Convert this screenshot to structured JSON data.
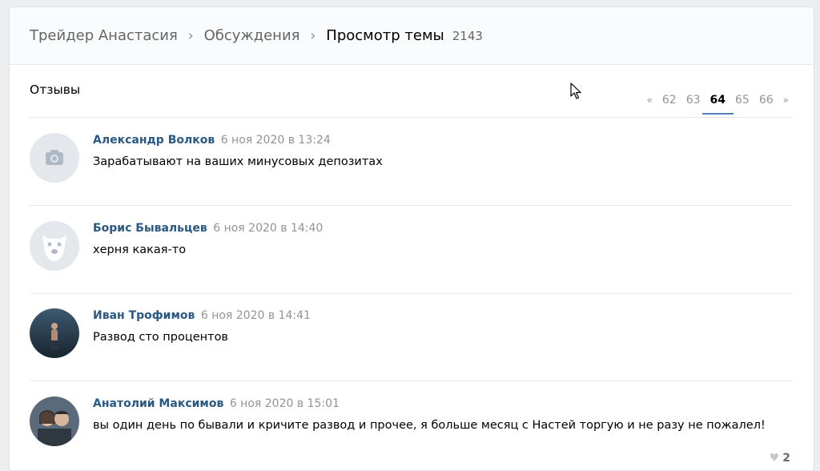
{
  "breadcrumb": {
    "group": "Трейдер Анастасия",
    "section": "Обсуждения",
    "current": "Просмотр темы",
    "count": "2143"
  },
  "topic": {
    "title": "Отзывы"
  },
  "pager": {
    "prev": "«",
    "pages": [
      "62",
      "63",
      "64",
      "65",
      "66"
    ],
    "active": "64",
    "next": "»"
  },
  "posts": [
    {
      "author": "Александр Волков",
      "date": "6 ноя 2020 в 13:24",
      "text": "Зарабатывают на ваших минусовых депозитах",
      "avatar": "camera-placeholder"
    },
    {
      "author": "Борис Бывальцев",
      "date": "6 ноя 2020 в 14:40",
      "text": "херня какая-то",
      "avatar": "deactivated-dog"
    },
    {
      "author": "Иван Трофимов",
      "date": "6 ноя 2020 в 14:41",
      "text": "Развод сто процентов",
      "avatar": "photo"
    },
    {
      "author": "Анатолий Максимов",
      "date": "6 ноя 2020 в 15:01",
      "text": "вы один день по бывали и кричите развод и прочее, я больше месяц с Настей торгую и не разу не пожалел!",
      "avatar": "photo",
      "likes": "2"
    }
  ],
  "colors": {
    "link": "#2a5885",
    "muted": "#939393",
    "accent": "#5181b8"
  }
}
